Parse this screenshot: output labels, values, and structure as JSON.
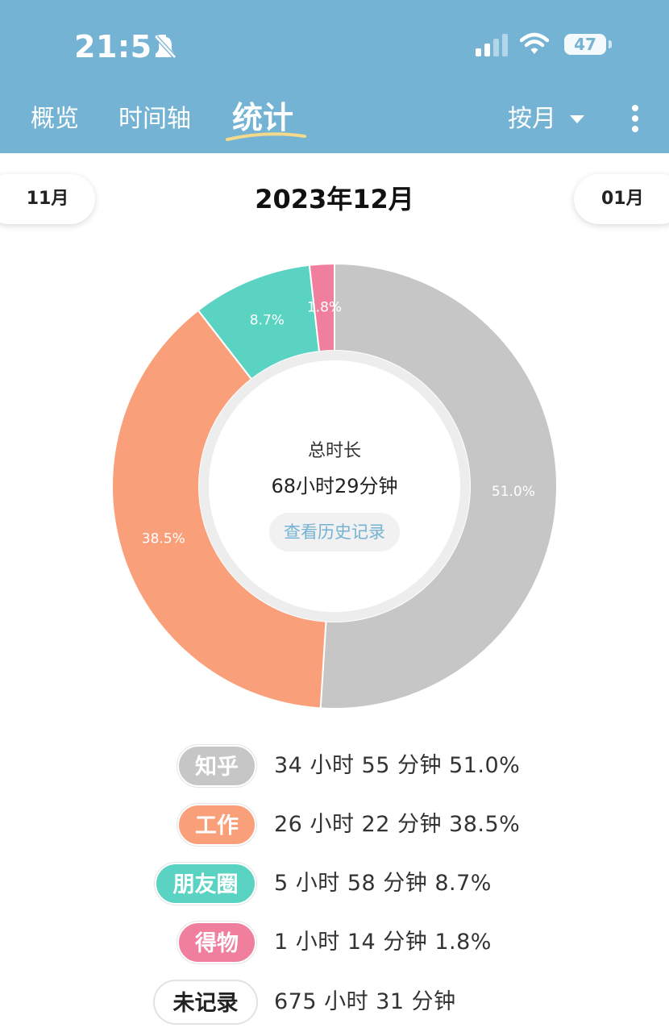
{
  "status_bar": {
    "time": "21:51",
    "battery": "47",
    "icons": [
      "bell-off-icon",
      "signal-icon",
      "wifi-icon",
      "battery-icon"
    ]
  },
  "nav": {
    "tabs": [
      {
        "label": "概览",
        "active": false
      },
      {
        "label": "时间轴",
        "active": false
      },
      {
        "label": "统计",
        "active": true
      }
    ],
    "period_mode": "按月",
    "icons": [
      "caret-down-icon",
      "more-vertical-icon"
    ]
  },
  "period": {
    "prev": "11月",
    "title": "2023年12月",
    "next": "01月"
  },
  "summary": {
    "title": "总时长",
    "total": "68小时29分钟",
    "history_button": "查看历史记录"
  },
  "chart_data": {
    "type": "pie",
    "categories": [
      "知乎",
      "工作",
      "朋友圈",
      "得物"
    ],
    "values": [
      51.0,
      38.5,
      8.7,
      1.8
    ],
    "labels": [
      "51.0%",
      "38.5%",
      "8.7%",
      "1.8%"
    ],
    "colors": [
      "#c6c6c6",
      "#f9a07a",
      "#5ad3c3",
      "#f07f9e"
    ],
    "start_angle_deg": 0,
    "direction": "clockwise"
  },
  "legend": [
    {
      "name": "知乎",
      "text": "34 小时 55 分钟 51.0%",
      "color": "#c6c6c6"
    },
    {
      "name": "工作",
      "text": "26 小时 22 分钟 38.5%",
      "color": "#f9a07a"
    },
    {
      "name": "朋友圈",
      "text": "5 小时 58 分钟 8.7%",
      "color": "#5ad3c3"
    },
    {
      "name": "得物",
      "text": "1 小时 14 分钟 1.8%",
      "color": "#f07f9e"
    },
    {
      "name": "未记录",
      "text": "675 小时 31 分钟",
      "color": "#ffffff"
    }
  ]
}
